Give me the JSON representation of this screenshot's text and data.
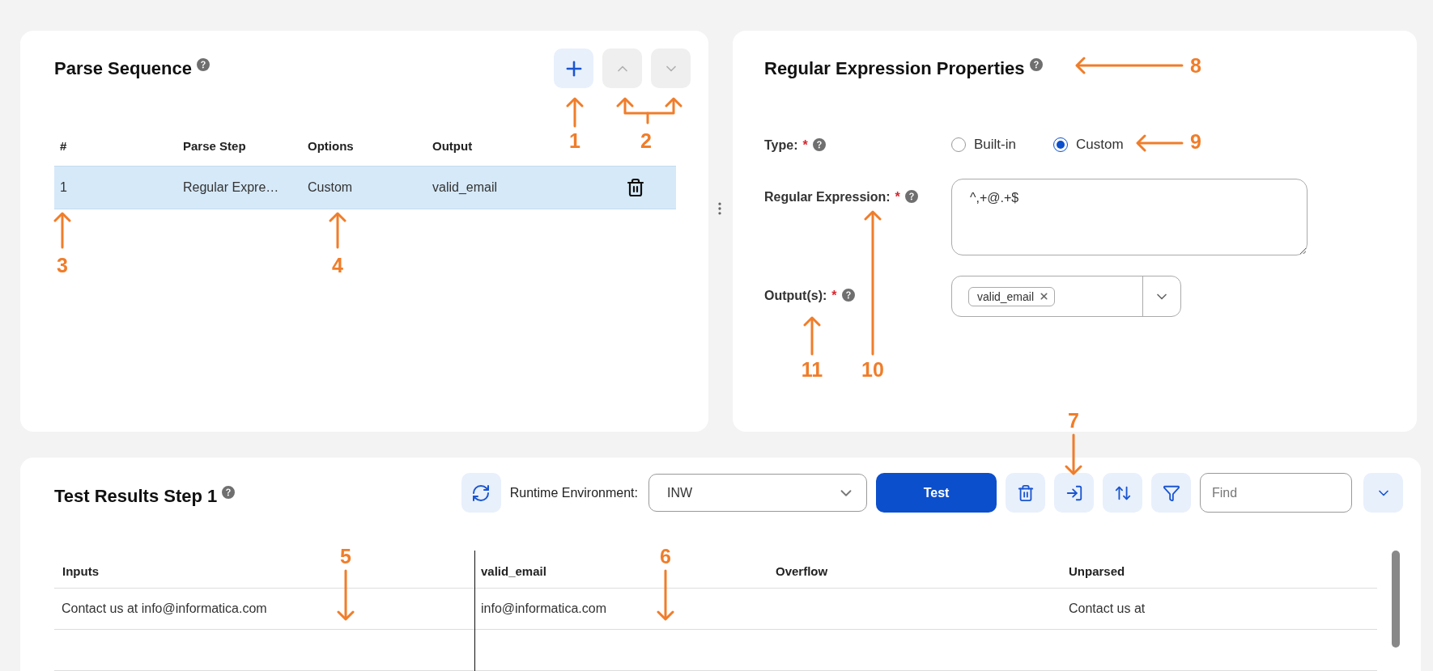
{
  "parse_sequence": {
    "title": "Parse Sequence",
    "buttons": [
      {
        "kind": "add",
        "disabled": false
      },
      {
        "kind": "up",
        "disabled": true
      },
      {
        "kind": "down",
        "disabled": true
      }
    ],
    "columns": [
      "#",
      "Parse Step",
      "Options",
      "Output"
    ],
    "rows": [
      {
        "cells": [
          "1",
          "Regular Expre…",
          "Custom",
          "valid_email"
        ],
        "selected": true
      }
    ]
  },
  "properties": {
    "title": "Regular Expression Properties",
    "fields": [
      {
        "kind": "radio",
        "label": "Type:",
        "required_mark": "*",
        "options": [
          {
            "label": "Built-in",
            "selected": false
          },
          {
            "label": "Custom",
            "selected": true
          }
        ]
      },
      {
        "kind": "textarea",
        "label": "Regular Expression:",
        "required_mark": "*",
        "value": "^,+@.+$"
      },
      {
        "kind": "multiselect",
        "label": "Output(s):",
        "required_mark": "*",
        "tags": [
          "valid_email"
        ]
      }
    ]
  },
  "test_results": {
    "title": "Test Results Step 1",
    "runtime_label": "Runtime Environment:",
    "runtime_value": "INW",
    "test_button": "Test",
    "tools": [
      {
        "kind": "delete"
      },
      {
        "kind": "import"
      },
      {
        "kind": "sort"
      },
      {
        "kind": "filter"
      }
    ],
    "find_placeholder": "Find",
    "columns": [
      "Inputs",
      "valid_email",
      "Overflow",
      "Unparsed"
    ],
    "rows": [
      [
        "Contact us at info@informatica.com",
        "info@informatica.com",
        null,
        "Contact us at"
      ]
    ]
  },
  "annotations": [
    {
      "label": "1"
    },
    {
      "label": "2"
    },
    {
      "label": "3"
    },
    {
      "label": "4"
    },
    {
      "label": "5"
    },
    {
      "label": "6"
    },
    {
      "label": "7"
    },
    {
      "label": "8"
    },
    {
      "label": "9"
    },
    {
      "label": "10"
    },
    {
      "label": "11"
    }
  ]
}
